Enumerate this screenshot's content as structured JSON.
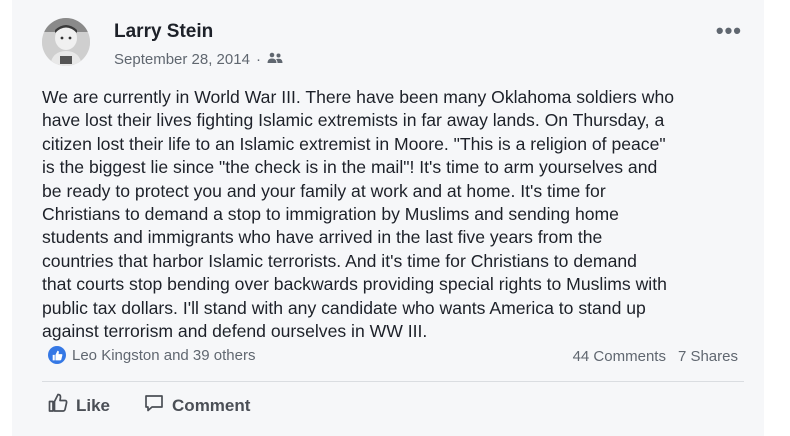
{
  "post": {
    "author": "Larry Stein",
    "date": "September 28, 2014",
    "audience_icon": "friends-icon",
    "menu_icon": "more-options-icon",
    "menu_glyph": "•••",
    "body_lines": [
      "We are currently in World War III.  There have been many Oklahoma soldiers who",
      "have lost their lives fighting Islamic extremists in far away lands.  On Thursday, a",
      "citizen lost their life to an Islamic extremist in Moore.  \"This is a religion of peace\"",
      "is the biggest lie since \"the check is in the mail\"!  It's time to arm yourselves and",
      "be ready to protect you and your family at work and at home.  It's time for",
      "Christians to demand a stop to immigration by Muslims and sending home",
      "students and immigrants who have arrived in the last five years from the",
      "countries that harbor Islamic terrorists.  And it's time for Christians to demand",
      "that courts stop bending over backwards providing special rights to Muslims with",
      "public tax dollars.  I'll stand with any candidate who wants America to stand up",
      "against terrorism and defend ourselves in WW III."
    ]
  },
  "footer": {
    "reactions": "Leo Kingston and 39 others",
    "comments": "44 Comments",
    "shares": "7 Shares",
    "like_label": "Like",
    "comment_label": "Comment"
  },
  "colors": {
    "accent": "#3578e5",
    "text": "#1d2129",
    "meta": "#606770"
  }
}
